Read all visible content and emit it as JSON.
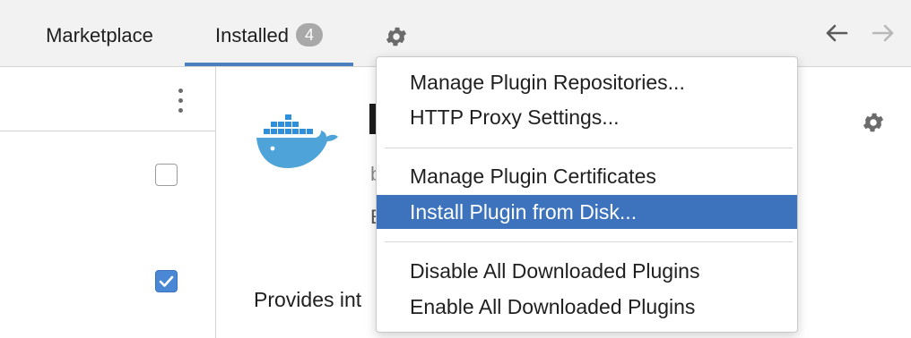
{
  "tabs": {
    "marketplace": "Marketplace",
    "installed": "Installed",
    "installed_count": "4",
    "active": "installed"
  },
  "icons": {
    "settings": "gear-icon",
    "back": "arrow-left-icon",
    "forward": "arrow-right-icon",
    "more": "kebab-menu-icon",
    "plugin_logo": "docker-whale-icon"
  },
  "colors": {
    "accent": "#4a7fc0",
    "selected_item": "#3d73bd",
    "badge": "#a9a9a9",
    "checkbox_checked": "#4a88d6",
    "docker_blue": "#2f8fd8"
  },
  "plugin_list": {
    "rows": [
      {
        "checked": false
      },
      {
        "checked": true
      }
    ]
  },
  "detail": {
    "title_fragment": "",
    "byline_fragment": "b",
    "info_fragment": "E",
    "description_fragment": "Provides int"
  },
  "menu": {
    "groups": [
      [
        "Manage Plugin Repositories...",
        "HTTP Proxy Settings..."
      ],
      [
        "Manage Plugin Certificates",
        "Install Plugin from Disk..."
      ],
      [
        "Disable All Downloaded Plugins",
        "Enable All Downloaded Plugins"
      ]
    ],
    "highlighted": "Install Plugin from Disk..."
  }
}
